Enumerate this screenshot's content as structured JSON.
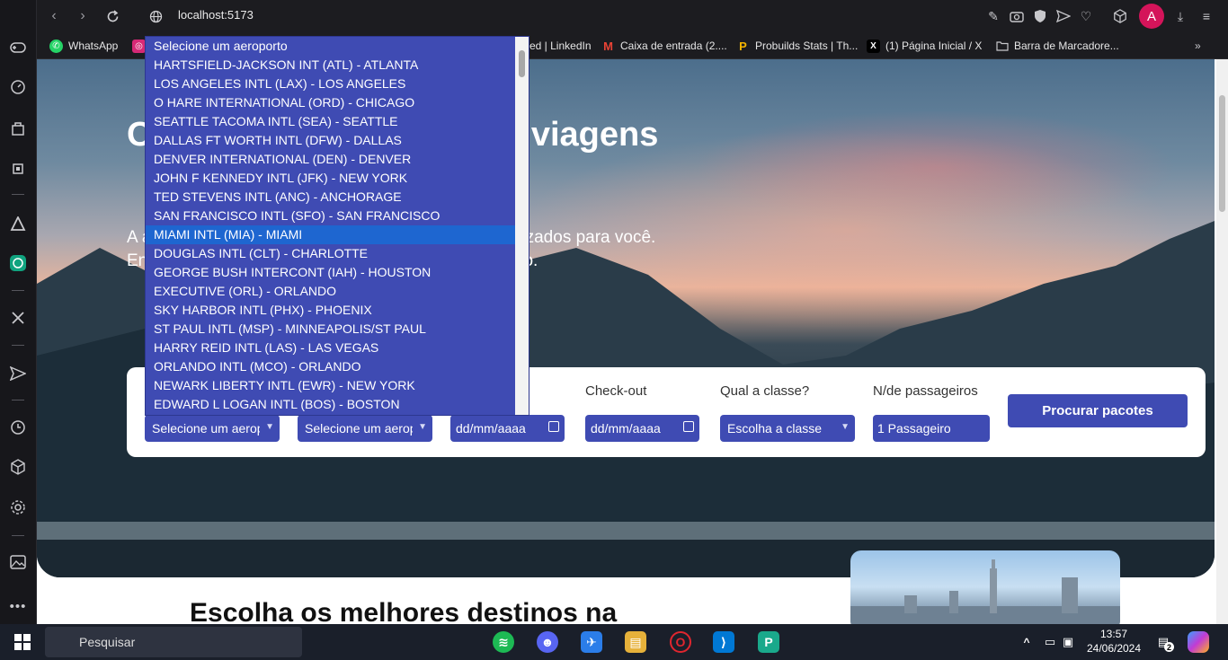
{
  "browser": {
    "url": "localhost:5173",
    "avatar_initial": "A",
    "accent": "#d4145a"
  },
  "bookmarks": [
    {
      "label": "WhatsApp",
      "icon": "whatsapp-icon",
      "color": "#25d366"
    },
    {
      "label": "ed | LinkedIn",
      "icon": "linkedin-icon",
      "color": "#0a66c2"
    },
    {
      "label": "Caixa de entrada (2....",
      "icon": "gmail-icon",
      "color": "#ea4335"
    },
    {
      "label": "Probuilds Stats | Th...",
      "icon": "probuilds-icon",
      "color": "#f4b400"
    },
    {
      "label": "(1) Página Inicial / X",
      "icon": "x-icon",
      "color": "#000000"
    },
    {
      "label": "Barra de Marcadore...",
      "icon": "folder-icon",
      "color": "#9a9aa0"
    }
  ],
  "hero": {
    "title": "Os melhores pacotes de viagens",
    "subtitle": "A agência de viagens que oferece serviços personalizados para você. Encontre os melhores preços e o melhor atendimento."
  },
  "search": {
    "labels": {
      "checkout": "Check-out",
      "class": "Qual a classe?",
      "passengers": "N/de passageiros"
    },
    "origin_value": "Selecione um aeroporto",
    "destination_value": "Selecione um aeroporto",
    "checkin_value": "dd/mm/aaaa",
    "checkout_value": "dd/mm/aaaa",
    "class_value": "Escolha a classe",
    "passengers_value": "1 Passageiro",
    "button": "Procurar pacotes",
    "brand_color": "#3f4bb3"
  },
  "dropdown": {
    "selected_index": 9,
    "options": [
      "Selecione um aeroporto",
      "HARTSFIELD-JACKSON INT (ATL) - ATLANTA",
      "LOS ANGELES INTL (LAX) - LOS ANGELES",
      "O HARE INTERNATIONAL (ORD) - CHICAGO",
      "SEATTLE TACOMA INTL (SEA) - SEATTLE",
      "DALLAS FT WORTH INTL (DFW) - DALLAS",
      "DENVER INTERNATIONAL (DEN) - DENVER",
      "JOHN F KENNEDY INTL (JFK) - NEW YORK",
      "TED STEVENS INTL (ANC) - ANCHORAGE",
      "SAN FRANCISCO INTL (SFO) - SAN FRANCISCO",
      "MIAMI INTL (MIA) - MIAMI",
      "DOUGLAS INTL (CLT) - CHARLOTTE",
      "GEORGE BUSH INTERCONT (IAH) - HOUSTON",
      "EXECUTIVE (ORL) - ORLANDO",
      "SKY HARBOR INTL (PHX) - PHOENIX",
      "ST PAUL INTL (MSP) - MINNEAPOLIS/ST PAUL",
      "HARRY REID INTL (LAS) - LAS VEGAS",
      "ORLANDO INTL (MCO) - ORLANDO",
      "NEWARK LIBERTY INTL (EWR) - NEW YORK",
      "EDWARD L LOGAN INTL (BOS) - BOSTON"
    ]
  },
  "section": {
    "title": "Escolha os melhores destinos na"
  },
  "taskbar": {
    "search_placeholder": "Pesquisar",
    "time": "13:57",
    "date": "24/06/2024",
    "notification_count": "2"
  }
}
